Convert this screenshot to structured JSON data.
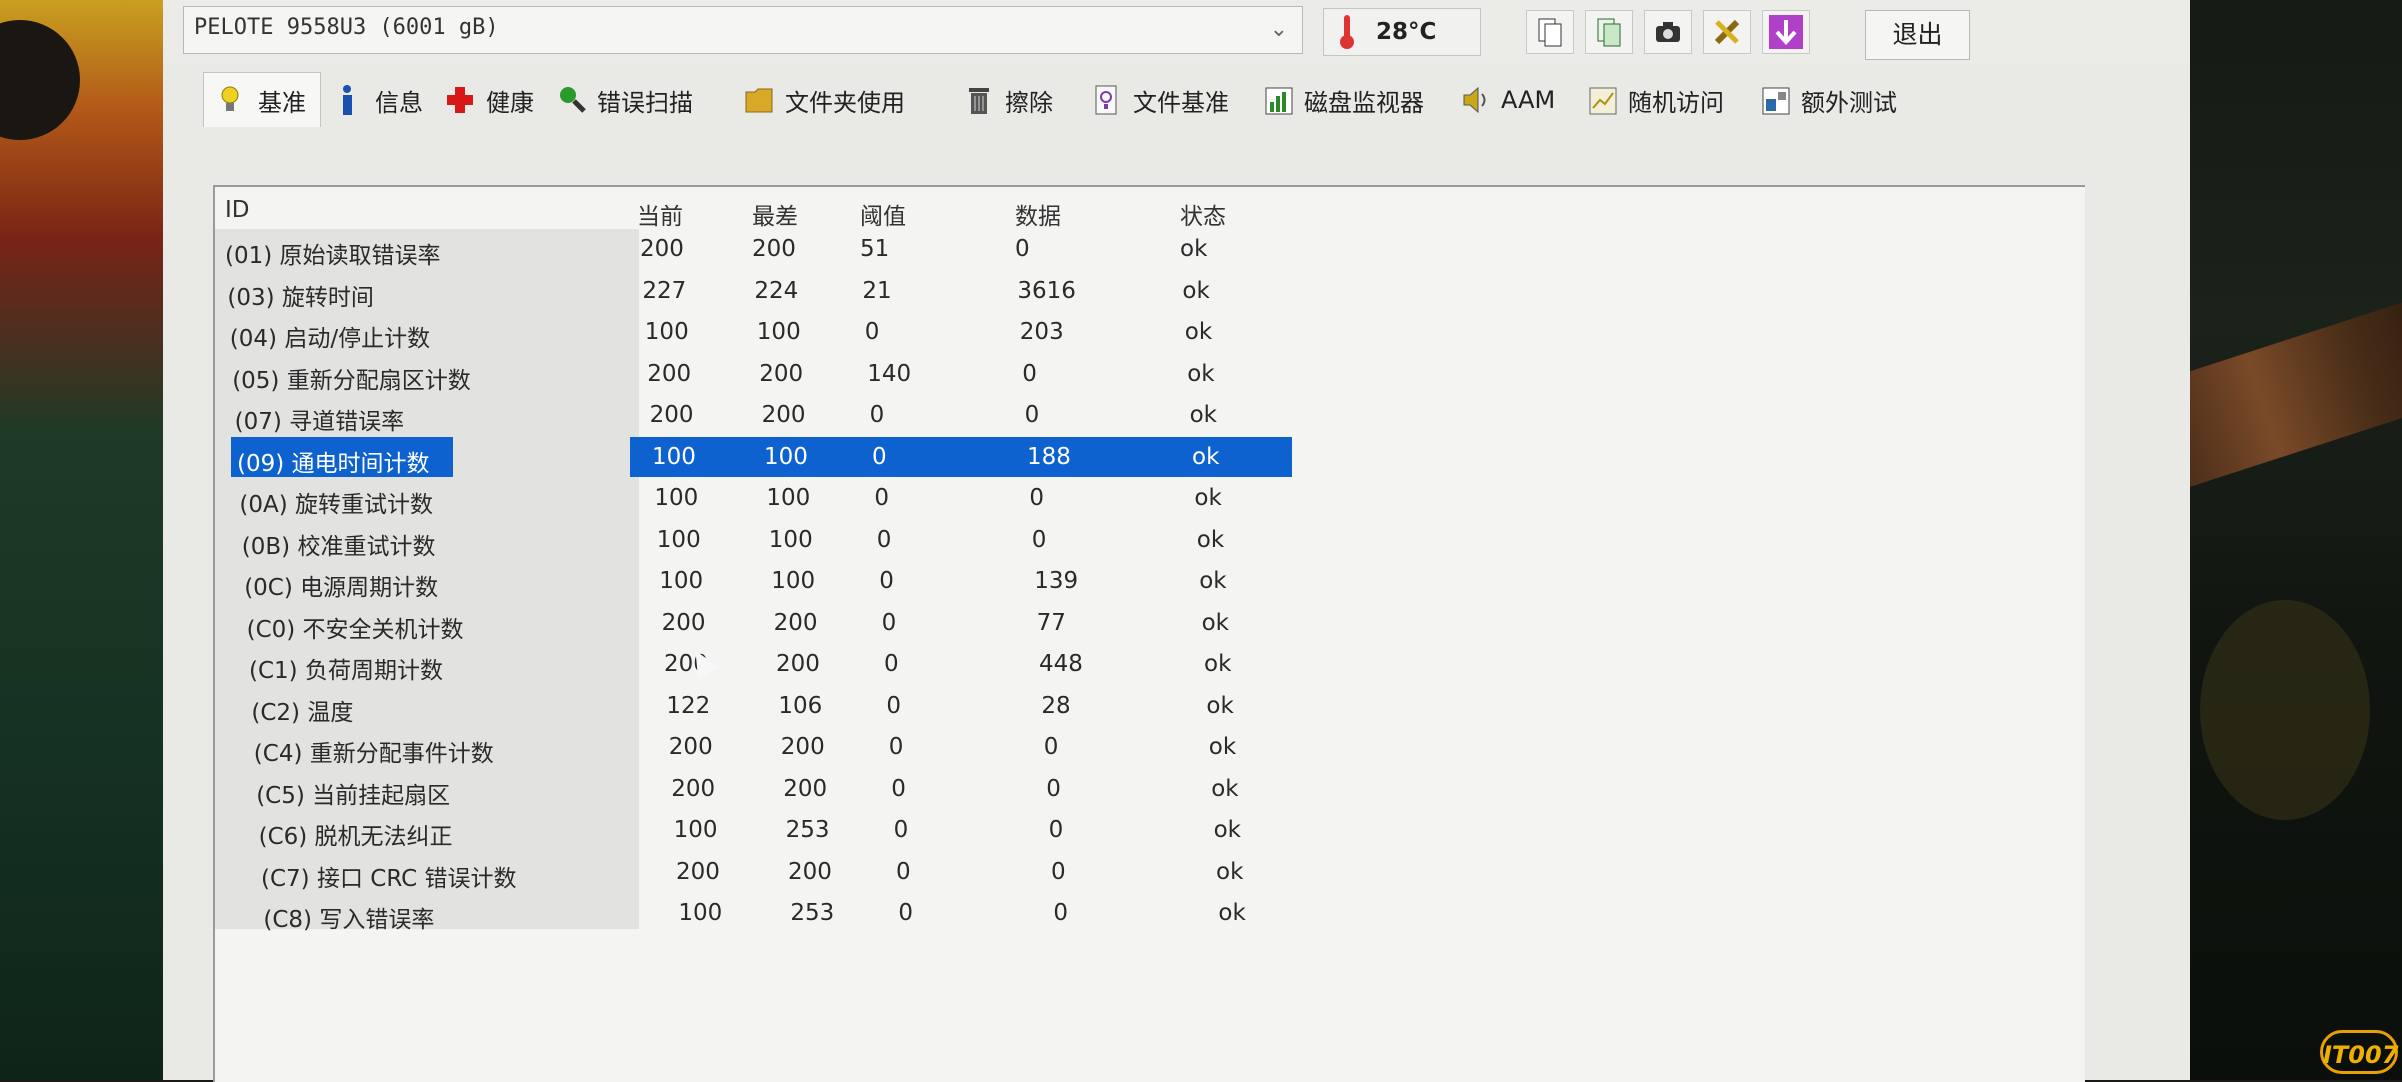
{
  "drive": {
    "label": "PELOTE  9558U3 (6001 gB)"
  },
  "temperature": {
    "value": "28"
  },
  "toolbar": {
    "exit_label": "退出"
  },
  "tabs": [
    {
      "label": "基准",
      "icon": "lightbulb-icon"
    },
    {
      "label": "信息",
      "icon": "info-icon"
    },
    {
      "label": "健康",
      "icon": "health-cross-icon"
    },
    {
      "label": "错误扫描",
      "icon": "magnifier-icon"
    },
    {
      "label": "文件夹使用",
      "icon": "folder-icon"
    },
    {
      "label": "擦除",
      "icon": "trash-icon"
    },
    {
      "label": "文件基准",
      "icon": "file-benchmark-icon"
    },
    {
      "label": "磁盘监视器",
      "icon": "disk-monitor-icon"
    },
    {
      "label": "AAM",
      "icon": "speaker-icon"
    },
    {
      "label": "随机访问",
      "icon": "random-access-icon"
    },
    {
      "label": "额外测试",
      "icon": "extra-tests-icon"
    }
  ],
  "table": {
    "headers": [
      "ID",
      "当前",
      "最差",
      "阈值",
      "数据",
      "状态"
    ],
    "rows": [
      [
        "(01) 原始读取错误率",
        "200",
        "200",
        "51",
        "0",
        "ok"
      ],
      [
        "(03) 旋转时间",
        "227",
        "224",
        "21",
        "3616",
        "ok"
      ],
      [
        "(04) 启动/停止计数",
        "100",
        "100",
        "0",
        "203",
        "ok"
      ],
      [
        "(05) 重新分配扇区计数",
        "200",
        "200",
        "140",
        "0",
        "ok"
      ],
      [
        "(07) 寻道错误率",
        "200",
        "200",
        "0",
        "0",
        "ok"
      ],
      [
        "(09) 通电时间计数",
        "100",
        "100",
        "0",
        "188",
        "ok"
      ],
      [
        "(0A) 旋转重试计数",
        "100",
        "100",
        "0",
        "0",
        "ok"
      ],
      [
        "(0B) 校准重试计数",
        "100",
        "100",
        "0",
        "0",
        "ok"
      ],
      [
        "(0C) 电源周期计数",
        "100",
        "100",
        "0",
        "139",
        "ok"
      ],
      [
        "(C0) 不安全关机计数",
        "200",
        "200",
        "0",
        "77",
        "ok"
      ],
      [
        "(C1) 负荷周期计数",
        "200",
        "200",
        "0",
        "448",
        "ok"
      ],
      [
        "(C2) 温度",
        "122",
        "106",
        "0",
        "28",
        "ok"
      ],
      [
        "(C4) 重新分配事件计数",
        "200",
        "200",
        "0",
        "0",
        "ok"
      ],
      [
        "(C5) 当前挂起扇区",
        "200",
        "200",
        "0",
        "0",
        "ok"
      ],
      [
        "(C6) 脱机无法纠正",
        "100",
        "253",
        "0",
        "0",
        "ok"
      ],
      [
        "(C7) 接口 CRC 错误计数",
        "200",
        "200",
        "0",
        "0",
        "ok"
      ],
      [
        "(C8) 写入错误率",
        "100",
        "253",
        "0",
        "0",
        "ok"
      ]
    ],
    "selected_row": 5
  },
  "watermark": "IT007"
}
